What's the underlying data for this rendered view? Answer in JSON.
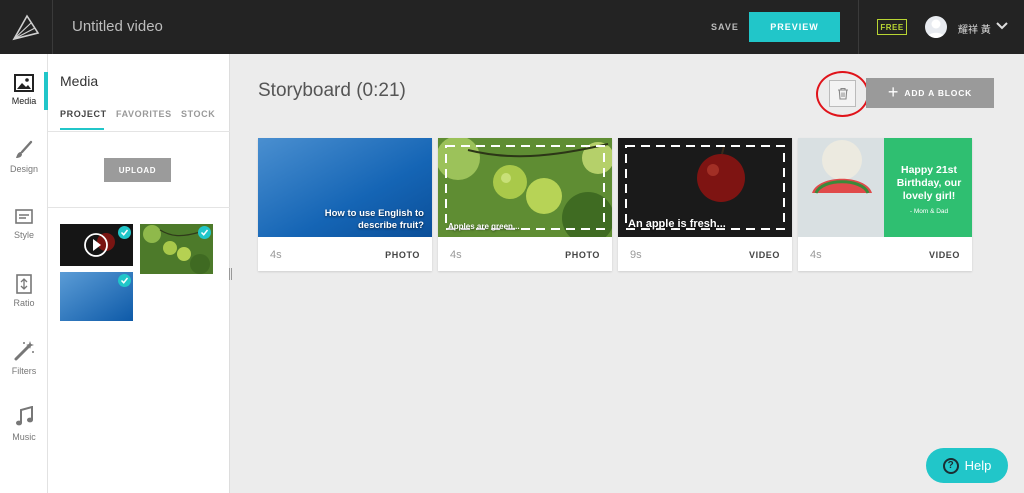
{
  "header": {
    "video_title": "Untitled video",
    "save_label": "SAVE",
    "preview_label": "PREVIEW",
    "plan_badge": "FREE",
    "user_name": "耀祥 黃"
  },
  "rail": {
    "items": [
      {
        "label": "Media",
        "icon": "image-icon"
      },
      {
        "label": "Design",
        "icon": "brush-icon"
      },
      {
        "label": "Style",
        "icon": "style-icon"
      },
      {
        "label": "Ratio",
        "icon": "ratio-icon"
      },
      {
        "label": "Filters",
        "icon": "wand-icon"
      },
      {
        "label": "Music",
        "icon": "music-note-icon"
      }
    ]
  },
  "panel": {
    "title": "Media",
    "tabs": [
      "PROJECT",
      "FAVORITES",
      "STOCK"
    ],
    "upload_label": "UPLOAD"
  },
  "storyboard": {
    "title": "Storyboard (0:21)",
    "add_block_label": "ADD A BLOCK",
    "cards": [
      {
        "duration": "4s",
        "type": "PHOTO",
        "caption": "How to use English to describe fruit?"
      },
      {
        "duration": "4s",
        "type": "PHOTO",
        "caption": "Apples are green..."
      },
      {
        "duration": "9s",
        "type": "VIDEO",
        "caption": "An apple is fresh..."
      },
      {
        "duration": "4s",
        "type": "VIDEO",
        "caption_lines": [
          "Happy 21st",
          "Birthday, our",
          "lovely girl!"
        ],
        "caption_sub": "- Mom & Dad"
      }
    ]
  },
  "help_label": "Help",
  "colors": {
    "accent": "#21c6c9",
    "topbar": "#232323",
    "badge": "#b8d433",
    "highlight_ring": "#e0131a",
    "card_green": "#2fbf71"
  }
}
